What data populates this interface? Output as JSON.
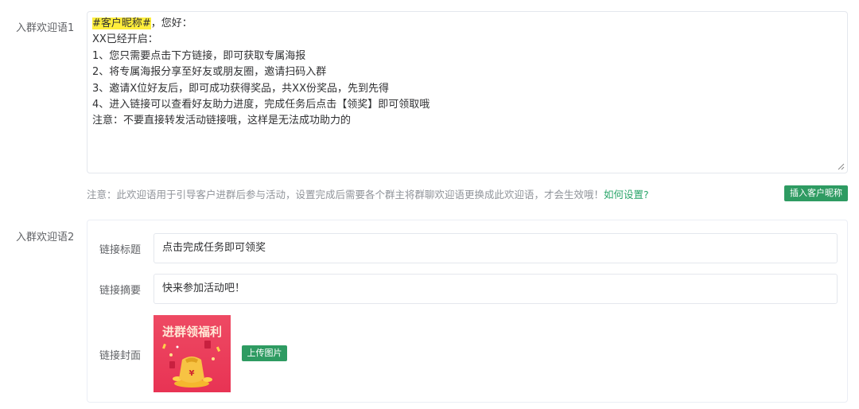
{
  "welcome1": {
    "label": "入群欢迎语1",
    "highlight": "#客户昵称#",
    "line0_rest": "，您好：",
    "lines": [
      "XX已经开启：",
      "1、您只需要点击下方链接，即可获取专属海报",
      "2、将专属海报分享至好友或朋友圈，邀请扫码入群",
      "3、邀请X位好友后，即可成功获得奖品，共XX份奖品，先到先得",
      "4、进入链接可以查看好友助力进度，完成任务后点击【领奖】即可领取哦",
      "注意：不要直接转发活动链接哦，这样是无法成功助力的"
    ],
    "note": "注意：此欢迎语用于引导客户进群后参与活动，设置完成后需要各个群主将群聊欢迎语更换成此欢迎语，才会生效哦！",
    "note_link": "如何设置?",
    "insert_button": "插入客户昵称"
  },
  "welcome2": {
    "label": "入群欢迎语2",
    "link_title_label": "链接标题",
    "link_title_value": "点击完成任务即可领奖",
    "link_summary_label": "链接摘要",
    "link_summary_value": "快来参加活动吧！",
    "link_cover_label": "链接封面",
    "cover_text": "进群领福利",
    "upload_button": "上传图片"
  },
  "colors": {
    "accent_green": "#2e9b62",
    "highlight_yellow": "#ffee3b",
    "cover_red": "#e83354"
  }
}
